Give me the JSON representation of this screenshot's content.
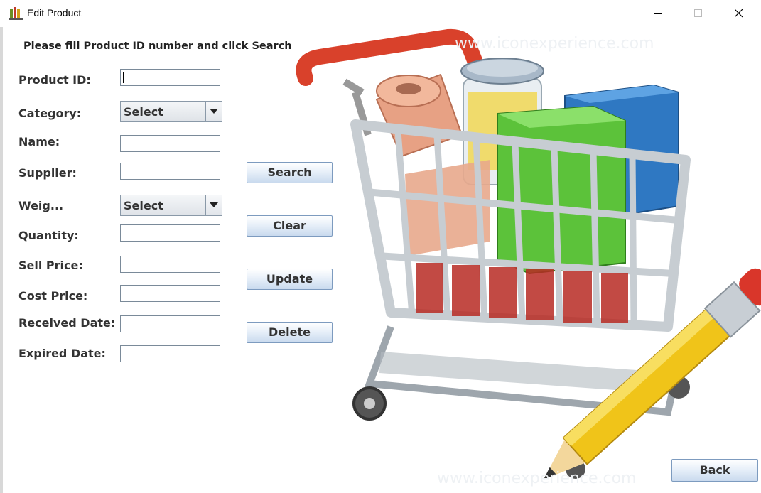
{
  "window": {
    "title": "Edit Product",
    "icon": "app-icon",
    "controls": [
      "minimize-icon",
      "maximize-icon",
      "close-icon"
    ]
  },
  "form": {
    "hint": "Please fill Product ID number and click Search",
    "fields": [
      {
        "label": "Product ID:",
        "type": "text",
        "value": ""
      },
      {
        "label": "Category:",
        "type": "select",
        "value": "Select"
      },
      {
        "label": "Name:",
        "type": "text",
        "value": ""
      },
      {
        "label": "Supplier:",
        "type": "text",
        "value": ""
      },
      {
        "label": "Weig...",
        "type": "select",
        "value": "Select"
      },
      {
        "label": "Quantity:",
        "type": "text",
        "value": ""
      },
      {
        "label": "Sell Price:",
        "type": "text",
        "value": ""
      },
      {
        "label": "Cost Price:",
        "type": "text",
        "value": ""
      },
      {
        "label": "Received Date:",
        "type": "text",
        "value": ""
      },
      {
        "label": "Expired Date:",
        "type": "text",
        "value": ""
      }
    ]
  },
  "actions": {
    "search": "Search",
    "clear": "Clear",
    "update": "Update",
    "delete": "Delete",
    "back": "Back"
  },
  "illustration": {
    "description_icon": "shopping-cart-with-pencil-icon",
    "watermark": "www.iconexperience.com"
  },
  "colors": {
    "button_border": "#7d9bbf",
    "button_bottom": "#c9daee",
    "label_text": "#333333"
  }
}
